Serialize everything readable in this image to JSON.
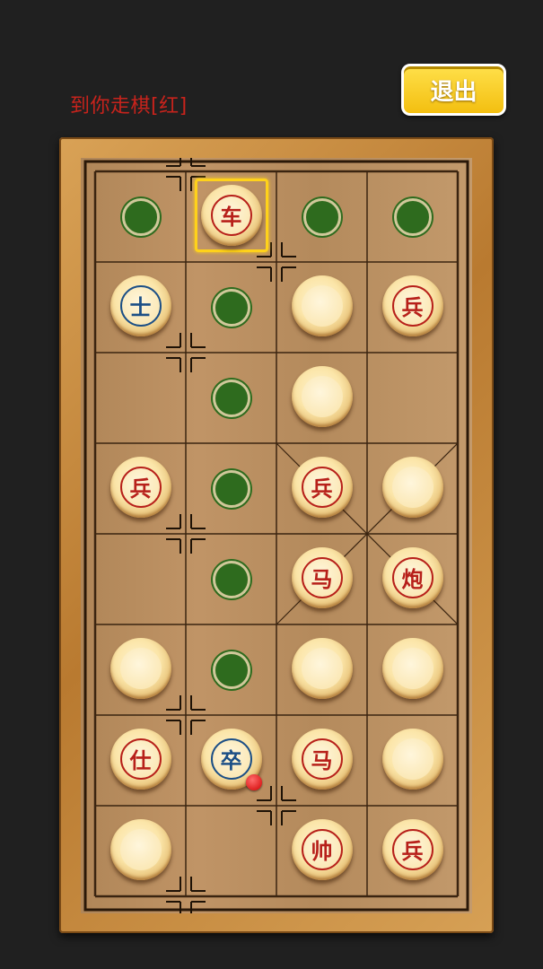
{
  "status_text": "到你走棋[红]",
  "exit_label": "退出",
  "colors": {
    "red_text": "#b7201a",
    "blue_text": "#1c4f86",
    "move_dot": "#2e6b1e",
    "selection": "#ffd21a",
    "exit_button": "#f3bf10"
  },
  "board": {
    "cols": 4,
    "rows": 8
  },
  "pieces": [
    {
      "col": 1,
      "row": 0,
      "label": "车",
      "side": "red",
      "selected": true
    },
    {
      "col": 0,
      "row": 1,
      "label": "士",
      "side": "blue"
    },
    {
      "col": 2,
      "row": 1,
      "label": "",
      "side": "hidden"
    },
    {
      "col": 3,
      "row": 1,
      "label": "兵",
      "side": "red"
    },
    {
      "col": 2,
      "row": 2,
      "label": "",
      "side": "hidden"
    },
    {
      "col": 0,
      "row": 3,
      "label": "兵",
      "side": "red"
    },
    {
      "col": 2,
      "row": 3,
      "label": "兵",
      "side": "red"
    },
    {
      "col": 3,
      "row": 3,
      "label": "",
      "side": "hidden"
    },
    {
      "col": 2,
      "row": 4,
      "label": "马",
      "side": "red"
    },
    {
      "col": 3,
      "row": 4,
      "label": "炮",
      "side": "red"
    },
    {
      "col": 0,
      "row": 5,
      "label": "",
      "side": "hidden"
    },
    {
      "col": 2,
      "row": 5,
      "label": "",
      "side": "hidden"
    },
    {
      "col": 3,
      "row": 5,
      "label": "",
      "side": "hidden"
    },
    {
      "col": 0,
      "row": 6,
      "label": "仕",
      "side": "red"
    },
    {
      "col": 1,
      "row": 6,
      "label": "卒",
      "side": "blue",
      "last_move": true
    },
    {
      "col": 2,
      "row": 6,
      "label": "马",
      "side": "red"
    },
    {
      "col": 3,
      "row": 6,
      "label": "",
      "side": "hidden"
    },
    {
      "col": 0,
      "row": 7,
      "label": "",
      "side": "hidden"
    },
    {
      "col": 2,
      "row": 7,
      "label": "帅",
      "side": "red"
    },
    {
      "col": 3,
      "row": 7,
      "label": "兵",
      "side": "red"
    }
  ],
  "move_hints": [
    {
      "col": 0,
      "row": 0
    },
    {
      "col": 2,
      "row": 0
    },
    {
      "col": 3,
      "row": 0
    },
    {
      "col": 1,
      "row": 1
    },
    {
      "col": 1,
      "row": 2
    },
    {
      "col": 1,
      "row": 3
    },
    {
      "col": 1,
      "row": 4
    },
    {
      "col": 1,
      "row": 5
    }
  ]
}
